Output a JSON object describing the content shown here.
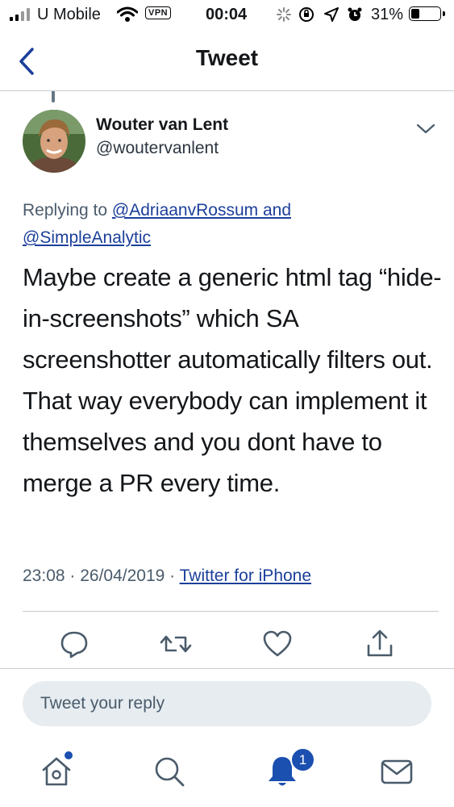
{
  "status_bar": {
    "carrier": "U Mobile",
    "vpn": "VPN",
    "time": "00:04",
    "battery": "31%",
    "battery_level": 0.31
  },
  "nav": {
    "title": "Tweet"
  },
  "tweet": {
    "author_name": "Wouter van Lent",
    "author_handle": "@woutervanlent",
    "replying_prefix": "Replying to",
    "mention_1": "@AdriaanvRossum and",
    "mention_2": "@SimpleAnalytic",
    "text": "Maybe create a generic html tag “hide-in-screenshots” which SA screenshotter automatically filters out. That way everybody can implement it themselves and you dont have to merge a PR every time.",
    "timestamp": "23:08 · 26/04/2019 ·",
    "source": "Twitter for iPhone"
  },
  "reply": {
    "placeholder": "Tweet your reply"
  },
  "tab_bar": {
    "notifications_badge": "1"
  },
  "colors": {
    "link": "#1b3f9a",
    "badge": "#1b4fb0"
  }
}
